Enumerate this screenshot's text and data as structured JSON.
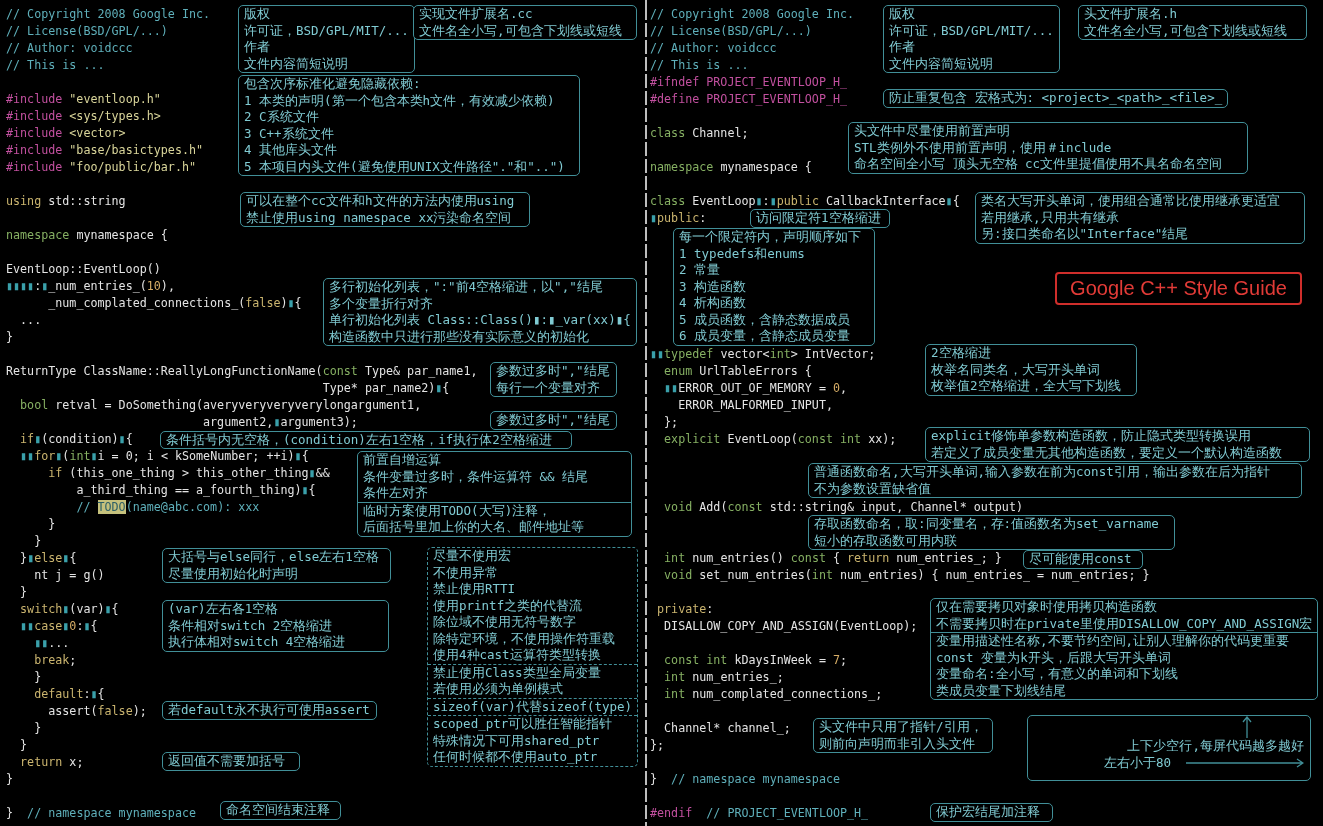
{
  "left_panel": {
    "code_lines": [
      {
        "kind": "code",
        "tokens": [
          {
            "kind": "comment",
            "text": "// Copyright 2008 Google Inc."
          }
        ]
      },
      {
        "kind": "code",
        "tokens": [
          {
            "kind": "comment",
            "text": "// License(BSD/GPL/...)"
          }
        ]
      },
      {
        "kind": "code",
        "tokens": [
          {
            "kind": "comment",
            "text": "// Author: voidccc"
          }
        ]
      },
      {
        "kind": "code",
        "tokens": [
          {
            "kind": "comment",
            "text": "// This is ..."
          }
        ]
      },
      {
        "kind": "blank"
      },
      {
        "kind": "code",
        "tokens": [
          {
            "kind": "preprocessor",
            "text": "#include"
          },
          {
            "kind": "string",
            "text": " \"eventloop.h\""
          }
        ]
      },
      {
        "kind": "code",
        "tokens": [
          {
            "kind": "preprocessor",
            "text": "#include"
          },
          {
            "kind": "string",
            "text": " <sys/types.h>"
          }
        ]
      },
      {
        "kind": "code",
        "tokens": [
          {
            "kind": "preprocessor",
            "text": "#include"
          },
          {
            "kind": "string",
            "text": " <vector>"
          }
        ]
      },
      {
        "kind": "code",
        "tokens": [
          {
            "kind": "preprocessor",
            "text": "#include"
          },
          {
            "kind": "string",
            "text": " \"base/basictypes.h\""
          }
        ]
      },
      {
        "kind": "code",
        "tokens": [
          {
            "kind": "preprocessor",
            "text": "#include"
          },
          {
            "kind": "string",
            "text": " \"foo/public/bar.h\""
          }
        ]
      },
      {
        "kind": "blank"
      },
      {
        "kind": "code",
        "tokens": [
          {
            "kind": "keyword",
            "text": "using"
          },
          {
            "kind": "plain",
            "text": " std::string"
          }
        ]
      },
      {
        "kind": "blank"
      },
      {
        "kind": "code",
        "tokens": [
          {
            "kind": "type",
            "text": "namespace"
          },
          {
            "kind": "plain",
            "text": " mynamespace {"
          }
        ]
      },
      {
        "kind": "blank"
      },
      {
        "kind": "code",
        "tokens": [
          {
            "kind": "plain",
            "text": "EventLoop::EventLoop()"
          }
        ]
      },
      {
        "kind": "code",
        "tokens": [
          {
            "kind": "mark",
            "text": "▮▮▮▮"
          },
          {
            "kind": "plain",
            "text": ":"
          },
          {
            "kind": "mark",
            "text": "▮"
          },
          {
            "kind": "plain",
            "text": "_num_entries_("
          },
          {
            "kind": "number",
            "text": "10"
          },
          {
            "kind": "plain",
            "text": "),"
          }
        ]
      },
      {
        "kind": "code",
        "tokens": [
          {
            "kind": "plain",
            "text": "      _num_complated_connections_("
          },
          {
            "kind": "keyword",
            "text": "false"
          },
          {
            "kind": "plain",
            "text": ")"
          },
          {
            "kind": "mark",
            "text": "▮"
          },
          {
            "kind": "plain",
            "text": "{"
          }
        ]
      },
      {
        "kind": "code",
        "tokens": [
          {
            "kind": "plain",
            "text": "  ..."
          }
        ]
      },
      {
        "kind": "code",
        "tokens": [
          {
            "kind": "plain",
            "text": "}"
          }
        ]
      },
      {
        "kind": "blank"
      },
      {
        "kind": "code",
        "tokens": [
          {
            "kind": "plain",
            "text": "ReturnType ClassName::ReallyLongFunctionName("
          },
          {
            "kind": "type",
            "text": "const"
          },
          {
            "kind": "plain",
            "text": " Type& par_name1,"
          }
        ]
      },
      {
        "kind": "code",
        "tokens": [
          {
            "kind": "plain",
            "text": "                                             Type* par_name2)"
          },
          {
            "kind": "mark",
            "text": "▮"
          },
          {
            "kind": "plain",
            "text": "{"
          }
        ]
      },
      {
        "kind": "code",
        "tokens": [
          {
            "kind": "type",
            "text": "  bool"
          },
          {
            "kind": "plain",
            "text": " retval = DoSomething(averyveryveryverylongargument1,"
          }
        ]
      },
      {
        "kind": "code",
        "tokens": [
          {
            "kind": "plain",
            "text": "                            argument2,"
          },
          {
            "kind": "mark",
            "text": "▮"
          },
          {
            "kind": "plain",
            "text": "argument3);"
          }
        ]
      },
      {
        "kind": "code",
        "tokens": [
          {
            "kind": "keyword",
            "text": "  if"
          },
          {
            "kind": "mark",
            "text": "▮"
          },
          {
            "kind": "plain",
            "text": "(condition)"
          },
          {
            "kind": "mark",
            "text": "▮"
          },
          {
            "kind": "plain",
            "text": "{"
          }
        ]
      },
      {
        "kind": "code",
        "tokens": [
          {
            "kind": "mark",
            "text": "  ▮▮"
          },
          {
            "kind": "keyword",
            "text": "for"
          },
          {
            "kind": "mark",
            "text": "▮"
          },
          {
            "kind": "plain",
            "text": "("
          },
          {
            "kind": "type",
            "text": "int"
          },
          {
            "kind": "mark",
            "text": "▮"
          },
          {
            "kind": "plain",
            "text": "i = 0; i < kSomeNumber; ++i)"
          },
          {
            "kind": "mark",
            "text": "▮"
          },
          {
            "kind": "plain",
            "text": "{"
          }
        ]
      },
      {
        "kind": "code",
        "tokens": [
          {
            "kind": "keyword",
            "text": "      if"
          },
          {
            "kind": "plain",
            "text": " (this_one_thing > this_other_thing"
          },
          {
            "kind": "mark",
            "text": "▮"
          },
          {
            "kind": "plain",
            "text": "&&"
          }
        ]
      },
      {
        "kind": "code",
        "tokens": [
          {
            "kind": "plain",
            "text": "          a_third_thing == a_fourth_thing)"
          },
          {
            "kind": "mark",
            "text": "▮"
          },
          {
            "kind": "plain",
            "text": "{"
          }
        ]
      },
      {
        "kind": "code",
        "tokens": [
          {
            "kind": "comment",
            "text": "          // "
          },
          {
            "kind": "todo",
            "text": "TODO"
          },
          {
            "kind": "comment",
            "text": "(name@abc.com): xxx"
          }
        ]
      },
      {
        "kind": "code",
        "tokens": [
          {
            "kind": "plain",
            "text": "      }"
          }
        ]
      },
      {
        "kind": "code",
        "tokens": [
          {
            "kind": "plain",
            "text": "    }"
          }
        ]
      },
      {
        "kind": "code",
        "tokens": [
          {
            "kind": "plain",
            "text": "  }"
          },
          {
            "kind": "mark",
            "text": "▮"
          },
          {
            "kind": "keyword",
            "text": "else"
          },
          {
            "kind": "mark",
            "text": "▮"
          },
          {
            "kind": "plain",
            "text": "{"
          }
        ]
      },
      {
        "kind": "code",
        "tokens": [
          {
            "kind": "plain",
            "text": "    nt j = g()"
          }
        ]
      },
      {
        "kind": "code",
        "tokens": [
          {
            "kind": "plain",
            "text": "  }"
          }
        ]
      },
      {
        "kind": "code",
        "tokens": [
          {
            "kind": "keyword",
            "text": "  switch"
          },
          {
            "kind": "mark",
            "text": "▮"
          },
          {
            "kind": "plain",
            "text": "(var)"
          },
          {
            "kind": "mark",
            "text": "▮"
          },
          {
            "kind": "plain",
            "text": "{"
          }
        ]
      },
      {
        "kind": "code",
        "tokens": [
          {
            "kind": "mark",
            "text": "  ▮▮"
          },
          {
            "kind": "keyword",
            "text": "case"
          },
          {
            "kind": "mark",
            "text": "▮"
          },
          {
            "kind": "number",
            "text": "0"
          },
          {
            "kind": "plain",
            "text": ":"
          },
          {
            "kind": "mark",
            "text": "▮"
          },
          {
            "kind": "plain",
            "text": "{"
          }
        ]
      },
      {
        "kind": "code",
        "tokens": [
          {
            "kind": "mark",
            "text": "    ▮▮"
          },
          {
            "kind": "plain",
            "text": "..."
          }
        ]
      },
      {
        "kind": "code",
        "tokens": [
          {
            "kind": "keyword",
            "text": "    break"
          },
          {
            "kind": "plain",
            "text": ";"
          }
        ]
      },
      {
        "kind": "code",
        "tokens": [
          {
            "kind": "plain",
            "text": "    }"
          }
        ]
      },
      {
        "kind": "code",
        "tokens": [
          {
            "kind": "keyword",
            "text": "    default"
          },
          {
            "kind": "plain",
            "text": ":"
          },
          {
            "kind": "mark",
            "text": "▮"
          },
          {
            "kind": "plain",
            "text": "{"
          }
        ]
      },
      {
        "kind": "code",
        "tokens": [
          {
            "kind": "plain",
            "text": "      assert("
          },
          {
            "kind": "keyword",
            "text": "false"
          },
          {
            "kind": "plain",
            "text": ");"
          }
        ]
      },
      {
        "kind": "code",
        "tokens": [
          {
            "kind": "plain",
            "text": "    }"
          }
        ]
      },
      {
        "kind": "code",
        "tokens": [
          {
            "kind": "plain",
            "text": "  }"
          }
        ]
      },
      {
        "kind": "code",
        "tokens": [
          {
            "kind": "keyword",
            "text": "  return"
          },
          {
            "kind": "plain",
            "text": " x;"
          }
        ]
      },
      {
        "kind": "code",
        "tokens": [
          {
            "kind": "plain",
            "text": "}"
          }
        ]
      },
      {
        "kind": "blank"
      },
      {
        "kind": "code",
        "tokens": [
          {
            "kind": "plain",
            "text": "}"
          },
          {
            "kind": "comment",
            "text": "  // namespace mynamespace"
          }
        ]
      }
    ],
    "notes": [
      {
        "dashed": false,
        "sections": [
          {
            "lines": [
              "版权",
              "许可证，BSD/GPL/MIT/...",
              "作者",
              "文件内容简短说明"
            ]
          }
        ]
      },
      {
        "dashed": false,
        "sections": [
          {
            "lines": [
              "实现文件扩展名.cc",
              "文件名全小写,可包含下划线或短线"
            ]
          }
        ]
      },
      {
        "dashed": false,
        "sections": [
          {
            "lines": [
              "包含次序标准化避免隐藏依赖:",
              "1 本类的声明(第一个包含本类h文件，有效减少依赖)",
              "2 C系统文件",
              "3 C++系统文件",
              "4 其他库头文件",
              "5 本项目内头文件(避免使用UNIX文件路径\".\"和\"..\")"
            ]
          }
        ]
      },
      {
        "dashed": false,
        "sections": [
          {
            "lines": [
              "可以在整个cc文件和h文件的方法内使用using",
              "禁止使用using namespace xx污染命名空间"
            ]
          }
        ]
      },
      {
        "dashed": false,
        "sections": [
          {
            "lines": [
              "多行初始化列表，\":\"前4空格缩进，以\",\"结尾",
              "多个变量折行对齐",
              "单行初始化列表 Class::Class()▮:▮_var(xx)▮{",
              "构造函数中只进行那些没有实际意义的初始化"
            ]
          }
        ]
      },
      {
        "dashed": false,
        "sections": [
          {
            "lines": [
              "参数过多时\",\"结尾",
              "每行一个变量对齐"
            ]
          }
        ]
      },
      {
        "dashed": false,
        "sections": [
          {
            "lines": [
              "参数过多时\",\"结尾"
            ]
          }
        ]
      },
      {
        "dashed": false,
        "sections": [
          {
            "lines": [
              "条件括号内无空格，(condition)左右1空格，if执行体2空格缩进"
            ]
          }
        ]
      },
      {
        "dashed": false,
        "sections": [
          {
            "lines": [
              "前置自增运算",
              "条件变量过多时，条件运算符 && 结尾",
              "条件左对齐"
            ]
          },
          {
            "lines": [
              "临时方案使用TODO(大写)注释，",
              "后面括号里加上你的大名、邮件地址等"
            ]
          }
        ]
      },
      {
        "dashed": false,
        "sections": [
          {
            "lines": [
              "大括号与else同行，else左右1空格",
              "尽量使用初始化时声明"
            ]
          }
        ]
      },
      {
        "dashed": true,
        "sections": [
          {
            "lines": [
              "尽量不使用宏",
              "不使用异常",
              "禁止使用RTTI",
              "使用printf之类的代替流",
              "除位域不使用无符号数字",
              "除特定环境，不使用操作符重载",
              "使用4种cast运算符类型转换"
            ]
          },
          {
            "lines": [
              "禁止使用Class类型全局变量",
              "若使用必须为单例模式"
            ]
          },
          {
            "lines": [
              "sizeof(var)代替sizeof(type)"
            ]
          },
          {
            "lines": [
              "scoped_ptr可以胜任智能指针",
              "特殊情况下可用shared_ptr",
              "任何时候都不使用auto_ptr"
            ]
          }
        ]
      },
      {
        "dashed": false,
        "sections": [
          {
            "lines": [
              "(var)左右各1空格",
              "条件相对switch 2空格缩进",
              "执行体相对switch 4空格缩进"
            ]
          }
        ]
      },
      {
        "dashed": false,
        "sections": [
          {
            "lines": [
              "若default永不执行可使用assert"
            ]
          }
        ]
      },
      {
        "dashed": false,
        "sections": [
          {
            "lines": [
              "返回值不需要加括号"
            ]
          }
        ]
      },
      {
        "dashed": false,
        "sections": [
          {
            "lines": [
              "命名空间结束注释"
            ]
          }
        ]
      }
    ]
  },
  "right_panel": {
    "code_lines": [
      {
        "kind": "code",
        "tokens": [
          {
            "kind": "comment",
            "text": "// Copyright 2008 Google Inc."
          }
        ]
      },
      {
        "kind": "code",
        "tokens": [
          {
            "kind": "comment",
            "text": "// License(BSD/GPL/...)"
          }
        ]
      },
      {
        "kind": "code",
        "tokens": [
          {
            "kind": "comment",
            "text": "// Author: voidccc"
          }
        ]
      },
      {
        "kind": "code",
        "tokens": [
          {
            "kind": "comment",
            "text": "// This is ..."
          }
        ]
      },
      {
        "kind": "code",
        "tokens": [
          {
            "kind": "preprocessor",
            "text": "#ifndef PROJECT_EVENTLOOP_H_"
          }
        ]
      },
      {
        "kind": "code",
        "tokens": [
          {
            "kind": "preprocessor",
            "text": "#define PROJECT_EVENTLOOP_H_"
          }
        ]
      },
      {
        "kind": "blank"
      },
      {
        "kind": "code",
        "tokens": [
          {
            "kind": "type",
            "text": "class"
          },
          {
            "kind": "plain",
            "text": " Channel;"
          }
        ]
      },
      {
        "kind": "blank"
      },
      {
        "kind": "code",
        "tokens": [
          {
            "kind": "type",
            "text": "namespace"
          },
          {
            "kind": "plain",
            "text": " mynamespace {"
          }
        ]
      },
      {
        "kind": "blank"
      },
      {
        "kind": "code",
        "tokens": [
          {
            "kind": "type",
            "text": "class"
          },
          {
            "kind": "plain",
            "text": " EventLoop"
          },
          {
            "kind": "mark",
            "text": "▮"
          },
          {
            "kind": "plain",
            "text": ":"
          },
          {
            "kind": "mark",
            "text": "▮"
          },
          {
            "kind": "keyword",
            "text": "public"
          },
          {
            "kind": "plain",
            "text": " CallbackInterface"
          },
          {
            "kind": "mark",
            "text": "▮"
          },
          {
            "kind": "plain",
            "text": "{"
          }
        ]
      },
      {
        "kind": "code",
        "tokens": [
          {
            "kind": "mark",
            "text": "▮"
          },
          {
            "kind": "keyword",
            "text": "public"
          },
          {
            "kind": "plain",
            "text": ":"
          }
        ]
      },
      {
        "kind": "blank"
      },
      {
        "kind": "blank"
      },
      {
        "kind": "blank"
      },
      {
        "kind": "blank"
      },
      {
        "kind": "blank"
      },
      {
        "kind": "blank"
      },
      {
        "kind": "blank"
      },
      {
        "kind": "code",
        "tokens": [
          {
            "kind": "mark",
            "text": "▮▮"
          },
          {
            "kind": "type",
            "text": "typedef"
          },
          {
            "kind": "plain",
            "text": " vector<"
          },
          {
            "kind": "type",
            "text": "int"
          },
          {
            "kind": "plain",
            "text": "> IntVector;"
          }
        ]
      },
      {
        "kind": "code",
        "tokens": [
          {
            "kind": "type",
            "text": "  enum"
          },
          {
            "kind": "plain",
            "text": " UrlTableErrors {"
          }
        ]
      },
      {
        "kind": "code",
        "tokens": [
          {
            "kind": "mark",
            "text": "  ▮▮"
          },
          {
            "kind": "plain",
            "text": "ERROR_OUT_OF_MEMORY = "
          },
          {
            "kind": "number",
            "text": "0"
          },
          {
            "kind": "plain",
            "text": ","
          }
        ]
      },
      {
        "kind": "code",
        "tokens": [
          {
            "kind": "plain",
            "text": "    ERROR_MALFORMED_INPUT,"
          }
        ]
      },
      {
        "kind": "code",
        "tokens": [
          {
            "kind": "plain",
            "text": "  };"
          }
        ]
      },
      {
        "kind": "code",
        "tokens": [
          {
            "kind": "type",
            "text": "  explicit"
          },
          {
            "kind": "plain",
            "text": " EventLoop("
          },
          {
            "kind": "type",
            "text": "const int"
          },
          {
            "kind": "plain",
            "text": " xx);"
          }
        ]
      },
      {
        "kind": "blank"
      },
      {
        "kind": "blank"
      },
      {
        "kind": "blank"
      },
      {
        "kind": "code",
        "tokens": [
          {
            "kind": "type",
            "text": "  void"
          },
          {
            "kind": "plain",
            "text": " Add("
          },
          {
            "kind": "type",
            "text": "const"
          },
          {
            "kind": "plain",
            "text": " std::string& input, Channel* output)"
          }
        ]
      },
      {
        "kind": "blank"
      },
      {
        "kind": "blank"
      },
      {
        "kind": "code",
        "tokens": [
          {
            "kind": "type",
            "text": "  int"
          },
          {
            "kind": "plain",
            "text": " num_entries() "
          },
          {
            "kind": "type",
            "text": "const"
          },
          {
            "kind": "plain",
            "text": " { "
          },
          {
            "kind": "keyword",
            "text": "return"
          },
          {
            "kind": "plain",
            "text": " num_entries_; }"
          }
        ]
      },
      {
        "kind": "code",
        "tokens": [
          {
            "kind": "type",
            "text": "  void"
          },
          {
            "kind": "plain",
            "text": " set_num_entries("
          },
          {
            "kind": "type",
            "text": "int"
          },
          {
            "kind": "plain",
            "text": " num_entries) { num_entries_ = num_entries; }"
          }
        ]
      },
      {
        "kind": "blank"
      },
      {
        "kind": "code",
        "tokens": [
          {
            "kind": "keyword",
            "text": " private"
          },
          {
            "kind": "plain",
            "text": ":"
          }
        ]
      },
      {
        "kind": "code",
        "tokens": [
          {
            "kind": "plain",
            "text": "  DISALLOW_COPY_AND_ASSIGN(EventLoop);"
          }
        ]
      },
      {
        "kind": "blank"
      },
      {
        "kind": "code",
        "tokens": [
          {
            "kind": "type",
            "text": "  const int"
          },
          {
            "kind": "plain",
            "text": " kDaysInWeek = "
          },
          {
            "kind": "number",
            "text": "7"
          },
          {
            "kind": "plain",
            "text": ";"
          }
        ]
      },
      {
        "kind": "code",
        "tokens": [
          {
            "kind": "type",
            "text": "  int"
          },
          {
            "kind": "plain",
            "text": " num_entries_;"
          }
        ]
      },
      {
        "kind": "code",
        "tokens": [
          {
            "kind": "type",
            "text": "  int"
          },
          {
            "kind": "plain",
            "text": " num_complated_connections_;"
          }
        ]
      },
      {
        "kind": "blank"
      },
      {
        "kind": "code",
        "tokens": [
          {
            "kind": "plain",
            "text": "  Channel* channel_;"
          }
        ]
      },
      {
        "kind": "code",
        "tokens": [
          {
            "kind": "plain",
            "text": "};"
          }
        ]
      },
      {
        "kind": "blank"
      },
      {
        "kind": "code",
        "tokens": [
          {
            "kind": "plain",
            "text": "}"
          },
          {
            "kind": "comment",
            "text": "  // namespace mynamespace"
          }
        ]
      },
      {
        "kind": "blank"
      },
      {
        "kind": "code",
        "tokens": [
          {
            "kind": "preprocessor",
            "text": "#endif"
          },
          {
            "kind": "comment",
            "text": "  // PROJECT_EVENTLOOP_H_"
          }
        ]
      }
    ],
    "notes": [
      {
        "dashed": false,
        "sections": [
          {
            "lines": [
              "版权",
              "许可证，BSD/GPL/MIT/...",
              "作者",
              "文件内容简短说明"
            ]
          }
        ]
      },
      {
        "dashed": false,
        "sections": [
          {
            "lines": [
              "头文件扩展名.h",
              "文件名全小写,可包含下划线或短线"
            ]
          }
        ]
      },
      {
        "dashed": false,
        "sections": [
          {
            "lines": [
              "防止重复包含 宏格式为: <project>_<path>_<file>_"
            ]
          }
        ]
      },
      {
        "dashed": false,
        "sections": [
          {
            "lines": [
              "头文件中尽量使用前置声明",
              "STL类例外不使用前置声明，使用＃include",
              "命名空间全小写 顶头无空格 cc文件里提倡使用不具名命名空间"
            ]
          }
        ]
      },
      {
        "dashed": false,
        "sections": [
          {
            "lines": [
              "访问限定符1空格缩进"
            ]
          }
        ]
      },
      {
        "dashed": false,
        "sections": [
          {
            "lines": [
              "类名大写开头单词，使用组合通常比使用继承更适宜",
              "若用继承,只用共有继承",
              "另:接口类命名以\"Interface\"结尾"
            ]
          }
        ]
      },
      {
        "dashed": false,
        "sections": [
          {
            "lines": [
              "每一个限定符内，声明顺序如下",
              "1 typedefs和enums",
              "2 常量",
              "3 构造函数",
              "4 析构函数",
              "5 成员函数，含静态数据成员",
              "6 成员变量，含静态成员变量"
            ]
          }
        ]
      },
      {
        "dashed": false,
        "sections": [
          {
            "lines": [
              "2空格缩进",
              "枚举名同类名，大写开头单词",
              "枚举值2空格缩进，全大写下划线"
            ]
          }
        ]
      },
      {
        "dashed": false,
        "sections": [
          {
            "lines": [
              "explicit修饰单参数构造函数，防止隐式类型转换误用",
              "若定义了成员变量无其他构造函数，要定义一个默认构造函数"
            ]
          }
        ]
      },
      {
        "dashed": false,
        "sections": [
          {
            "lines": [
              "普通函数命名,大写开头单词,输入参数在前为const引用，输出参数在后为指针",
              "不为参数设置缺省值"
            ]
          }
        ]
      },
      {
        "dashed": false,
        "sections": [
          {
            "lines": [
              "存取函数命名，取:同变量名，存:值函数名为set_varname",
              "短小的存取函数可用内联"
            ]
          }
        ]
      },
      {
        "dashed": false,
        "sections": [
          {
            "lines": [
              "尽可能使用const"
            ]
          }
        ]
      },
      {
        "dashed": false,
        "sections": [
          {
            "lines": [
              "仅在需要拷贝对象时使用拷贝构造函数",
              "不需要拷贝时在private里使用DISALLOW_COPY_AND_ASSIGN宏"
            ]
          },
          {
            "lines": [
              "变量用描述性名称,不要节约空间,让别人理解你的代码更重要",
              "const 变量为k开头，后跟大写开头单词",
              "变量命名:全小写，有意义的单词和下划线",
              "类成员变量下划线结尾"
            ]
          }
        ]
      },
      {
        "dashed": false,
        "sections": [
          {
            "lines": [
              "头文件中只用了指针/引用，",
              "则前向声明而非引入头文件"
            ]
          }
        ]
      },
      {
        "dashed": false,
        "sections": [
          {
            "lines": [
              "保护宏结尾加注释"
            ]
          }
        ]
      }
    ],
    "title_badge": "Google C++ Style Guide",
    "spacing_hint": {
      "lines": [
        "上下少空行,每屏代码越多越好",
        "左右小于80"
      ]
    }
  }
}
